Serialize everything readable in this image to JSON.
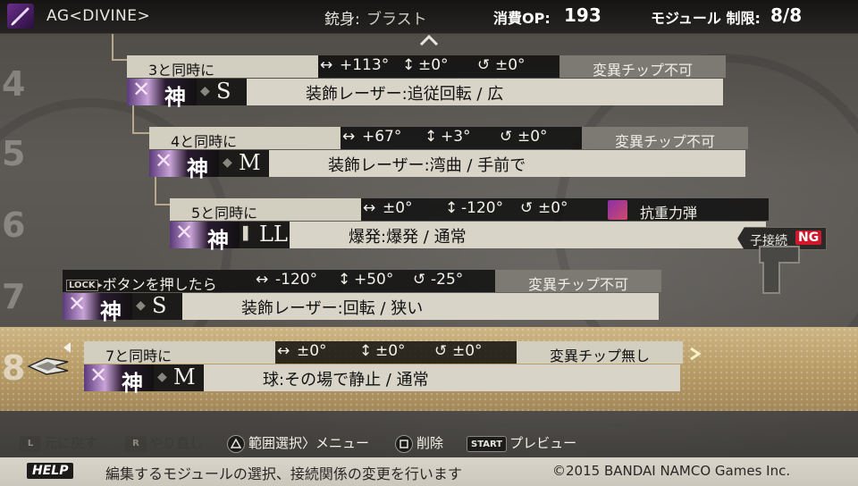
{
  "header": {
    "weapon_name": "AG<DIVINE>",
    "gun_label": "銃身:",
    "gun_value": "ブラスト",
    "op_label": "消費OP:",
    "op_value": "193",
    "module_label": "モジュール 制限:",
    "module_value": "8/8"
  },
  "row_numbers": [
    "4",
    "5",
    "6",
    "7",
    "8"
  ],
  "modules": [
    {
      "title": "3と同時に",
      "h_angle": "+113°",
      "v_angle": "±0°",
      "rotation": "±0°",
      "chip": "変異チップ不可",
      "kami": "神",
      "size": "S",
      "effect": "装飾レーザー:追従回転 / 広"
    },
    {
      "title": "4と同時に",
      "h_angle": "+67°",
      "v_angle": "+3°",
      "rotation": "±0°",
      "chip": "変異チップ不可",
      "kami": "神",
      "size": "M",
      "effect": "装飾レーザー:湾曲 / 手前で"
    },
    {
      "title": "5と同時に",
      "h_angle": "±0°",
      "v_angle": "-120°",
      "rotation": "±0°",
      "chip": "抗重力弾",
      "kami": "神",
      "size": "LL",
      "effect": "爆発:爆発 / 通常"
    },
    {
      "title": "ボタンを押したら",
      "title_prefix": "LOCK",
      "h_angle": "-120°",
      "v_angle": "+50°",
      "rotation": "-25°",
      "chip": "変異チップ不可",
      "kami": "神",
      "size": "S",
      "effect": "装飾レーザー:回転 / 狭い"
    },
    {
      "title": "7と同時に",
      "h_angle": "±0°",
      "v_angle": "±0°",
      "rotation": "±0°",
      "chip": "変異チップ無し",
      "kami": "神",
      "size": "M",
      "effect": "球:その場で静止 / 通常"
    }
  ],
  "child_connection": {
    "label": "子接続",
    "status": "NG"
  },
  "controls": {
    "undo": "元に戻す",
    "redo": "やり直し",
    "range_menu": "範囲選択〉メニュー",
    "delete": "削除",
    "preview": "プレビュー",
    "start_badge": "START"
  },
  "help": {
    "badge": "HELP",
    "text": "編集するモジュールの選択、接続関係の変更を行います",
    "copyright": "©2015 BANDAI NAMCO Games Inc."
  }
}
